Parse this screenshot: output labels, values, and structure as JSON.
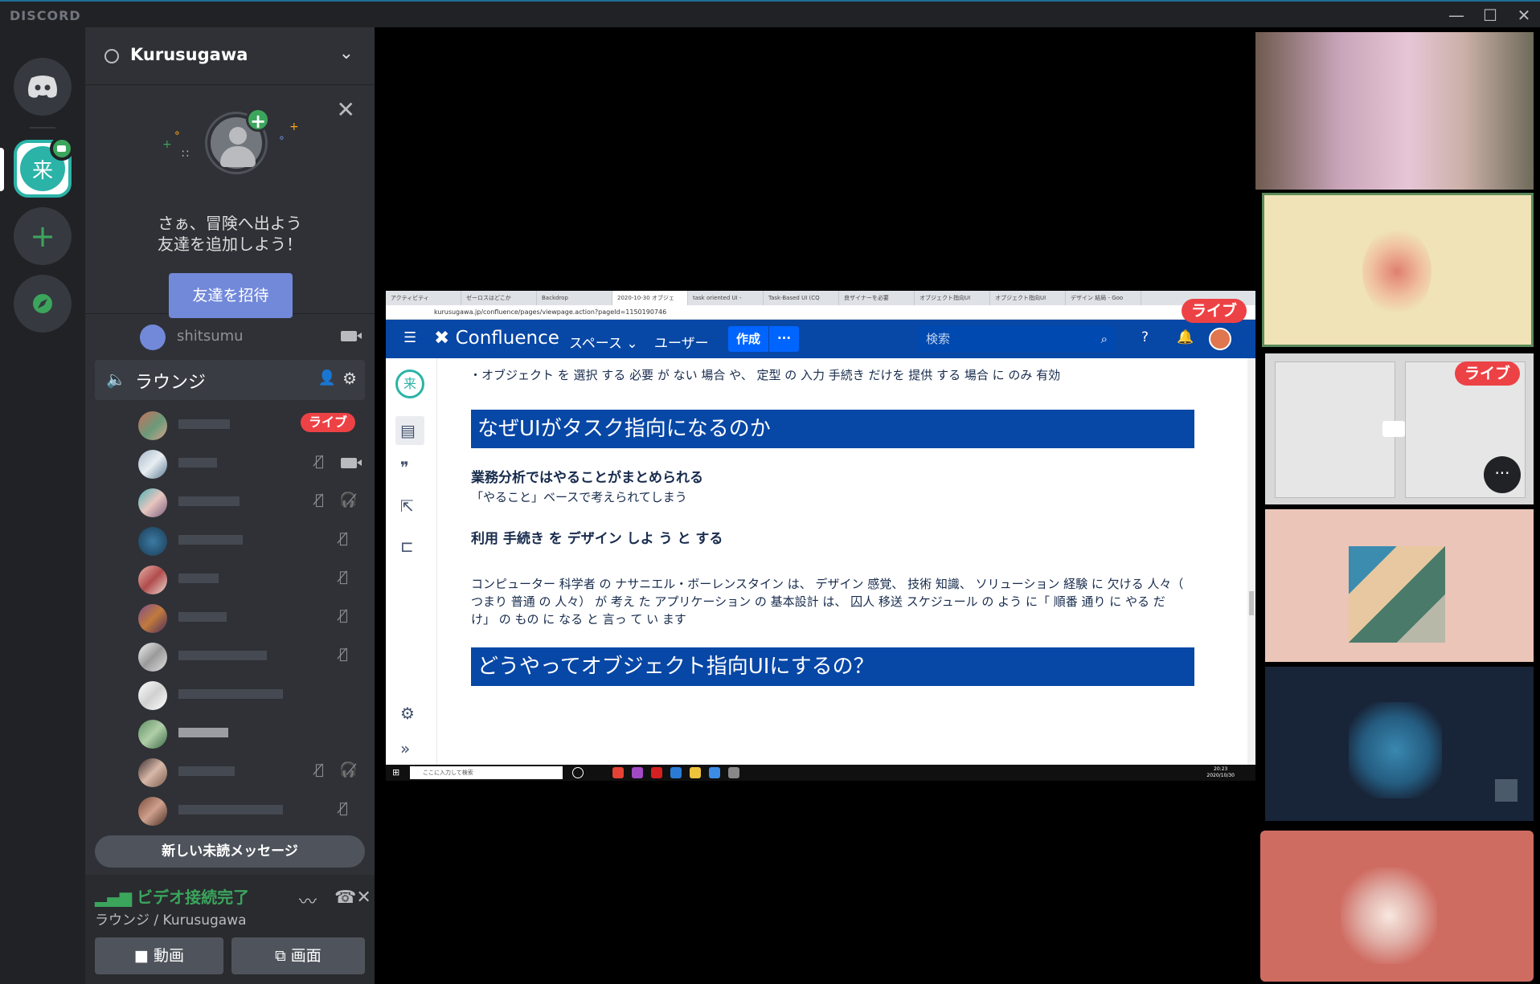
{
  "app": {
    "brand": "DISCORD"
  },
  "window_controls": {
    "minimize": "—",
    "maximize": "☐",
    "close": "✕"
  },
  "server": {
    "name": "Kurusugawa"
  },
  "invite_panel": {
    "line1": "さぁ、冒険へ出よう",
    "line2": "友達を追加しよう！",
    "button": "友達を招待"
  },
  "channels": {
    "text_like": {
      "name": "shitsumu"
    },
    "voice": {
      "name": "ラウンジ"
    }
  },
  "members": [
    {
      "live": true,
      "live_label": "ライブ",
      "muted": false,
      "deafened": false,
      "video": false
    },
    {
      "live": false,
      "muted": true,
      "deafened": false,
      "video": true
    },
    {
      "live": false,
      "muted": true,
      "deafened": true,
      "video": false
    },
    {
      "live": false,
      "muted": true,
      "deafened": false,
      "video": false
    },
    {
      "live": false,
      "muted": true,
      "deafened": false,
      "video": false
    },
    {
      "live": false,
      "muted": true,
      "deafened": false,
      "video": false
    },
    {
      "live": false,
      "muted": true,
      "deafened": false,
      "video": false
    },
    {
      "live": false,
      "muted": false,
      "deafened": false,
      "video": false
    },
    {
      "live": false,
      "muted": false,
      "deafened": false,
      "video": false
    },
    {
      "live": false,
      "muted": true,
      "deafened": true,
      "video": false
    },
    {
      "live": false,
      "muted": true,
      "deafened": false,
      "video": false
    }
  ],
  "unread_banner": "新しい未読メッセージ",
  "voice_panel": {
    "status": "ビデオ接続完了",
    "location": "ラウンジ / Kurusugawa",
    "video_button": "動画",
    "screen_button": "画面"
  },
  "stream": {
    "live_label": "ライブ",
    "browser_tabs": [
      "アクティビティ",
      "ゼーロスはどこか",
      "Backdrop",
      "2020-10-30 オブジェ",
      "task oriented UI -",
      "Task-Based UI (CQ",
      "良ザイナーを必要",
      "オブジェクト指向UI",
      "オブジェクト指向UI",
      "デザイン 結局 - Goo"
    ],
    "address": "kurusugawa.jp/confluence/pages/viewpage.action?pageId=1150190746",
    "confluence": {
      "logo": "Confluence",
      "nav_spaces": "スペース ⌄",
      "nav_users": "ユーザー",
      "create": "作成",
      "more": "···",
      "search_placeholder": "検索"
    },
    "content": {
      "bullet": "・オブジェクト を 選択 する 必要 が ない 場合 や、 定型 の 入力 手続き だけを 提供 する 場合 に のみ 有効",
      "heading1": "なぜUIがタスク指向になるのか",
      "sub1": "業務分析ではやることがまとめられる",
      "para1": "「やること」ベースで考えられてしまう",
      "sub2": "利用 手続き を デザイン しよ う と する",
      "para2": "コンピューター 科学者 の ナサニエル・ボーレンスタイン は、 デザイン 感覚、 技術 知識、 ソリューション 経験 に 欠ける 人々（ つまり 普通 の 人々） が 考え た アプリケーション の 基本設計 は、 囚人 移送 スケジュール の よう に「 順番 通り に やる だけ」 の もの に なる と 言っ て い ます",
      "heading2": "どうやってオブジェクト指向UIにするの？"
    },
    "taskbar_search": "ここに入力して検索",
    "taskbar_time": "20:23",
    "taskbar_date": "2020/10/30"
  },
  "tiles": [
    {
      "live": false
    },
    {
      "live": false
    },
    {
      "live": true,
      "live_label": "ライブ",
      "more": "···"
    },
    {
      "live": false
    },
    {
      "live": false
    },
    {
      "live": false
    }
  ],
  "colors": {
    "accent_blurple": "#7289da",
    "green": "#3ba55c",
    "live_red": "#ed4245",
    "confluence_blue": "#0747a6"
  }
}
